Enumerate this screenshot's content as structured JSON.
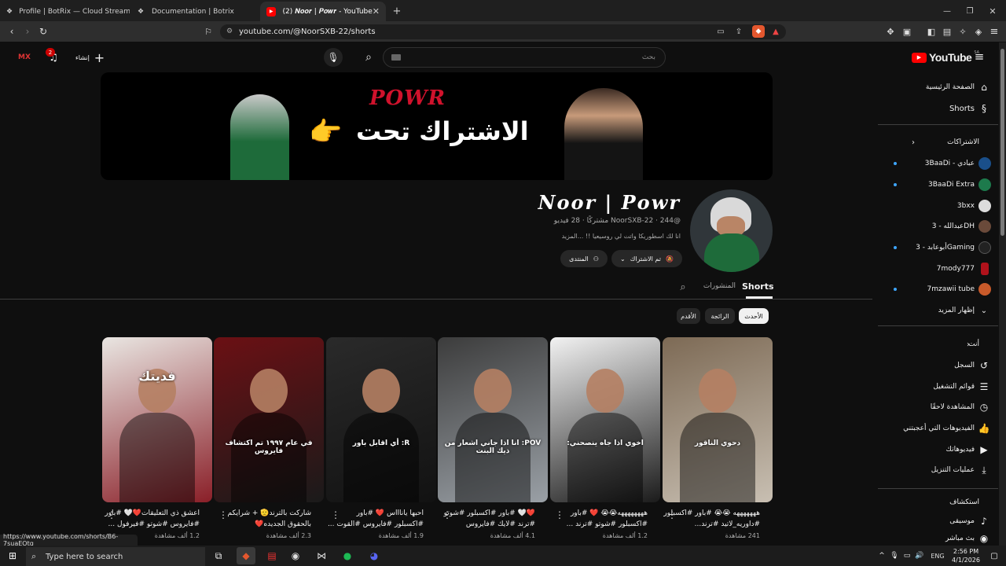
{
  "browser": {
    "tabs": [
      {
        "title": "Profile | BotRix — Cloud Streaming B"
      },
      {
        "title": "Documentation | Botrix"
      },
      {
        "title": "(2) 𝑵𝒐𝒐𝒓 | 𝑷𝒐𝒘𝒓 - YouTube"
      }
    ],
    "url": "youtube.com/@NoorSXB-22/shorts",
    "status_url": "https://www.youtube.com/shorts/B6-7suaEOtg"
  },
  "header": {
    "logo": "YouTube",
    "region": "SA",
    "search_placeholder": "بحث",
    "create_label": "إنشاء",
    "notif_count": "2",
    "user_initials": "MX"
  },
  "banner": {
    "brand": "POWR",
    "text": "الاشتراك تحت"
  },
  "channel": {
    "name": "𝑵𝒐𝒐𝒓 | 𝑷𝒐𝒘𝒓",
    "meta": "@NoorSXB-22 · 244 مشتركًا · 28 فيديو",
    "description": "انا لك اسطوريكا واتت لي روسيعيا !! ...المزيد",
    "subscribed_label": "تم الاشتراك",
    "community_label": "المنتدى"
  },
  "tabs": {
    "shorts": "Shorts",
    "posts": "المنشورات"
  },
  "chips": [
    "الأحدث",
    "الرائجة",
    "الأقدم"
  ],
  "shorts": [
    {
      "title": "اعشق ذي التعليقات❤️🤍 #باور #فايروس #شوتو #فيرفول ...",
      "views": "1.2 ألف مشاهدة",
      "caption": "فديتك",
      "bg1": "#e9e6e2",
      "bg2": "#8a1f28"
    },
    {
      "title": "شاركت بالترند🫡 + شرايكم بالحقوق الجديده❤️",
      "views": "2.3 ألف مشاهدة",
      "caption": "في عام ١٩٩٧ تم اكتشاف فايروس",
      "bg1": "#6b1014",
      "bg2": "#1a1a1a"
    },
    {
      "title": "احبها ياناااس ❤️ #باور #اكسبلور #فايروس #القوت ...",
      "views": "1.9 ألف مشاهدة",
      "caption": "R: أي اقابل باور",
      "bg1": "#2a2a2a",
      "bg2": "#121212"
    },
    {
      "title": "❤️🤍 #باور #اكسبلور #شوتو #ترند #لايك #فايروس",
      "views": "4.1 ألف مشاهدة",
      "caption": "POV: انا اذا جاني اشعار من ذيك البنت",
      "bg1": "#3c3c3c",
      "bg2": "#9aa0a6"
    },
    {
      "title": "ههههههههه😭😭 ❤️ #باور #اكسبلور #شوتو #ترند ...",
      "views": "1.2 ألف مشاهدة",
      "caption": "اخوي اذا جاه ينصحني:",
      "bg1": "#f2f2f2",
      "bg2": "#1b1b1b"
    },
    {
      "title": "هههههههه 😭😭 #باور #اكسبلور #داوريه_لاتيد #ترند...",
      "views": "241 مشاهدة",
      "caption": "دحوي الناقور",
      "bg1": "#7d6a55",
      "bg2": "#c8bfb2"
    }
  ],
  "sidebar": {
    "home": "الصفحة الرئيسية",
    "shorts": "Shorts",
    "subscriptions": "الاشتراكات",
    "subs": [
      {
        "name": "3BaaDi - عبادي",
        "dot": true,
        "color": "#1a4f8a"
      },
      {
        "name": "3BaaDi Extra",
        "dot": true,
        "color": "#1d7a4c"
      },
      {
        "name": "3bxx",
        "dot": false,
        "color": "#dcdcdc"
      },
      {
        "name": "عبدالله - 3DH",
        "dot": false,
        "color": "#6a4a3a"
      },
      {
        "name": "أبوعابد - 3Gaming",
        "dot": true,
        "color": "#222222"
      },
      {
        "name": "7mody777",
        "dot": false,
        "color": "#b0121b"
      },
      {
        "name": "7mzawii tube",
        "dot": true,
        "color": "#c85a2a"
      }
    ],
    "show_more": "إظهار المزيد",
    "you": "أنت",
    "you_items": [
      {
        "label": "السجل",
        "icon": "history-icon"
      },
      {
        "label": "قوائم التشغيل",
        "icon": "playlists-icon"
      },
      {
        "label": "المشاهدة لاحقًا",
        "icon": "watch-later-icon"
      },
      {
        "label": "الفيديوهات التي أعجبتني",
        "icon": "liked-icon"
      },
      {
        "label": "فيديوهاتك",
        "icon": "your-videos-icon"
      },
      {
        "label": "عمليات التنزيل",
        "icon": "downloads-icon"
      }
    ],
    "explore": "استكشاف",
    "explore_items": [
      {
        "label": "موسيقى",
        "icon": "music-icon"
      },
      {
        "label": "بث مباشر",
        "icon": "live-icon"
      }
    ]
  },
  "taskbar": {
    "search_placeholder": "Type here to search",
    "language": "ENG",
    "time": "2:56 PM",
    "date": "4/1/2026"
  }
}
